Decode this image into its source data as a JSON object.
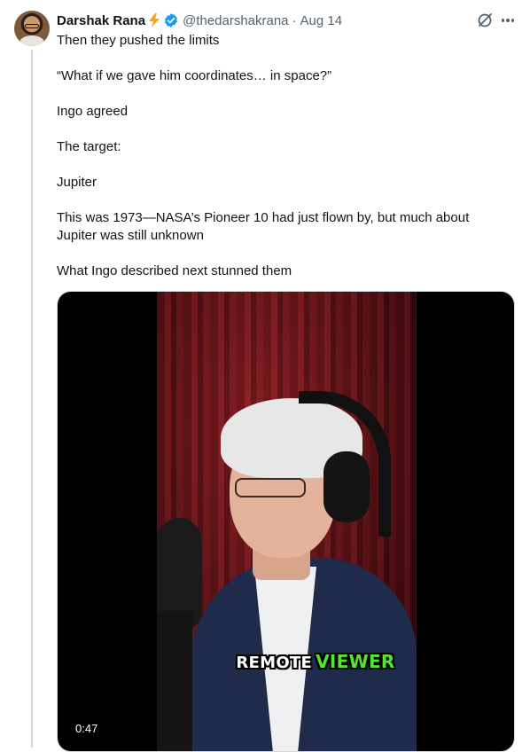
{
  "post": {
    "author": {
      "name": "Darshak Rana",
      "handle": "@thedarshakrana",
      "timestamp": "Aug 14",
      "badge_emoji_icon": "lightning-bolt-icon",
      "verified_icon": "verified-badge-icon",
      "verified_color": "#1d9bf0"
    },
    "paragraphs": [
      "Then they pushed the limits",
      "“What if we gave him coordinates… in space?”",
      "Ingo agreed",
      "The target:",
      "Jupiter",
      "This was 1973—NASA’s Pioneer 10 had just flown by, but much about Jupiter was still unknown",
      "What Ingo described next stunned them"
    ],
    "actions": {
      "grok_icon": "grok-icon",
      "more_icon": "more-options-icon"
    },
    "media": {
      "type": "video",
      "caption_part1": "REMOTE",
      "caption_part2": "VIEWER",
      "caption_accent_color": "#52e633",
      "duration": "0:47"
    }
  }
}
